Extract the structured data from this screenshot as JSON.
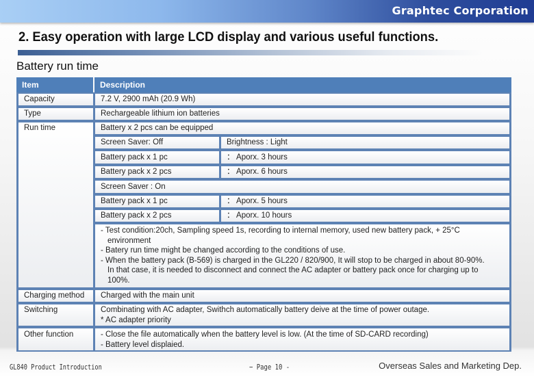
{
  "header": {
    "brand": "Graphtec Corporation",
    "title": "2. Easy operation with large LCD display and various useful functions.",
    "section": "Battery run time"
  },
  "table": {
    "columns": [
      "Item",
      "Description"
    ],
    "capacity": {
      "label": "Capacity",
      "value": "7.2 V, 2900 mAh (20.9 Wh)"
    },
    "type": {
      "label": "Type",
      "value": "Rechargeable lithium ion batteries"
    },
    "runtime": {
      "label": "Run time",
      "intro": "Battery x 2 pcs can be equipped",
      "saver_off": {
        "label": "Screen Saver:  Off",
        "brightness": "Brightness : Light",
        "rows": [
          {
            "pack": "Battery pack x 1 pc",
            "time": "： Aporx. 3 hours"
          },
          {
            "pack": "Battery pack x 2 pcs",
            "time": "： Aporx. 6 hours"
          }
        ]
      },
      "saver_on": {
        "label": "Screen Saver : On",
        "rows": [
          {
            "pack": "Battery pack x 1 pc",
            "time": "： Aporx. 5 hours"
          },
          {
            "pack": "Battery pack x 2 pcs",
            "time": "： Aporx. 10 hours"
          }
        ]
      },
      "notes": [
        "- Test condition:20ch, Sampling speed 1s, recording to internal memory, used new battery pack, + 25°C",
        "environment",
        "- Batery run time might be changed according to the conditions of use.",
        "- When the battery pack (B-569) is charged in the GL220 / 820/900, It will stop to be charged in about 80-90%.",
        "In that case, it is needed to disconnect and connect the AC adapter or battery pack once for charging up to",
        "100%."
      ]
    },
    "charging": {
      "label": "Charging method",
      "value": "Charged with the main unit"
    },
    "switching": {
      "label": "Switching",
      "lines": [
        "Combinating with AC adapter, Swithch automatically battery deive at the time of power outage.",
        "* AC adapter priority"
      ]
    },
    "other": {
      "label": "Other function",
      "lines": [
        "- Close the file automatically when the battery level is low. (At the time of SD-CARD recording)",
        "- Battery level displaied."
      ]
    }
  },
  "footer": {
    "left": "GL840 Product Introduction",
    "center": "− Page 10 -",
    "right": "Overseas Sales and Marketing Dep."
  }
}
